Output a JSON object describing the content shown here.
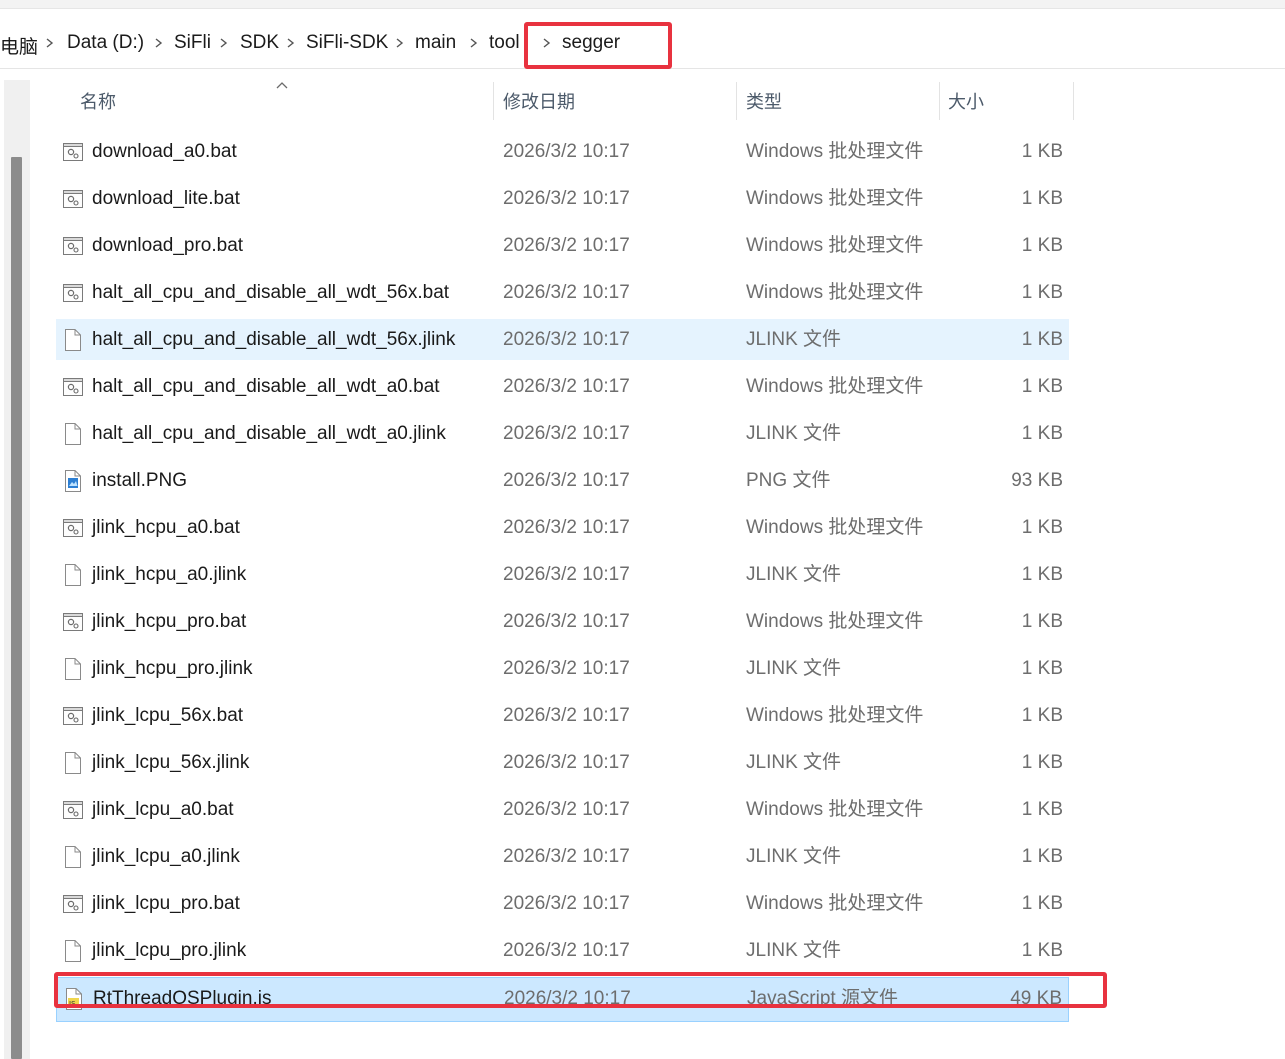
{
  "breadcrumb": {
    "items": [
      "电脑",
      "Data (D:)",
      "SiFli",
      "SDK",
      "SiFli-SDK",
      "main",
      "tool",
      "segger"
    ]
  },
  "columns": {
    "name": "名称",
    "date": "修改日期",
    "type": "类型",
    "size": "大小"
  },
  "files": [
    {
      "name": "download_a0.bat",
      "date": "2026/3/2 10:17",
      "type": "Windows 批处理文件",
      "size": "1 KB",
      "icon": "batch-file-icon"
    },
    {
      "name": "download_lite.bat",
      "date": "2026/3/2 10:17",
      "type": "Windows 批处理文件",
      "size": "1 KB",
      "icon": "batch-file-icon"
    },
    {
      "name": "download_pro.bat",
      "date": "2026/3/2 10:17",
      "type": "Windows 批处理文件",
      "size": "1 KB",
      "icon": "batch-file-icon"
    },
    {
      "name": "halt_all_cpu_and_disable_all_wdt_56x.bat",
      "date": "2026/3/2 10:17",
      "type": "Windows 批处理文件",
      "size": "1 KB",
      "icon": "batch-file-icon"
    },
    {
      "name": "halt_all_cpu_and_disable_all_wdt_56x.jlink",
      "date": "2026/3/2 10:17",
      "type": "JLINK 文件",
      "size": "1 KB",
      "icon": "blank-file-icon",
      "state": "hover"
    },
    {
      "name": "halt_all_cpu_and_disable_all_wdt_a0.bat",
      "date": "2026/3/2 10:17",
      "type": "Windows 批处理文件",
      "size": "1 KB",
      "icon": "batch-file-icon"
    },
    {
      "name": "halt_all_cpu_and_disable_all_wdt_a0.jlink",
      "date": "2026/3/2 10:17",
      "type": "JLINK 文件",
      "size": "1 KB",
      "icon": "blank-file-icon"
    },
    {
      "name": "install.PNG",
      "date": "2026/3/2 10:17",
      "type": "PNG 文件",
      "size": "93 KB",
      "icon": "image-file-icon"
    },
    {
      "name": "jlink_hcpu_a0.bat",
      "date": "2026/3/2 10:17",
      "type": "Windows 批处理文件",
      "size": "1 KB",
      "icon": "batch-file-icon"
    },
    {
      "name": "jlink_hcpu_a0.jlink",
      "date": "2026/3/2 10:17",
      "type": "JLINK 文件",
      "size": "1 KB",
      "icon": "blank-file-icon"
    },
    {
      "name": "jlink_hcpu_pro.bat",
      "date": "2026/3/2 10:17",
      "type": "Windows 批处理文件",
      "size": "1 KB",
      "icon": "batch-file-icon"
    },
    {
      "name": "jlink_hcpu_pro.jlink",
      "date": "2026/3/2 10:17",
      "type": "JLINK 文件",
      "size": "1 KB",
      "icon": "blank-file-icon"
    },
    {
      "name": "jlink_lcpu_56x.bat",
      "date": "2026/3/2 10:17",
      "type": "Windows 批处理文件",
      "size": "1 KB",
      "icon": "batch-file-icon"
    },
    {
      "name": "jlink_lcpu_56x.jlink",
      "date": "2026/3/2 10:17",
      "type": "JLINK 文件",
      "size": "1 KB",
      "icon": "blank-file-icon"
    },
    {
      "name": "jlink_lcpu_a0.bat",
      "date": "2026/3/2 10:17",
      "type": "Windows 批处理文件",
      "size": "1 KB",
      "icon": "batch-file-icon"
    },
    {
      "name": "jlink_lcpu_a0.jlink",
      "date": "2026/3/2 10:17",
      "type": "JLINK 文件",
      "size": "1 KB",
      "icon": "blank-file-icon"
    },
    {
      "name": "jlink_lcpu_pro.bat",
      "date": "2026/3/2 10:17",
      "type": "Windows 批处理文件",
      "size": "1 KB",
      "icon": "batch-file-icon"
    },
    {
      "name": "jlink_lcpu_pro.jlink",
      "date": "2026/3/2 10:17",
      "type": "JLINK 文件",
      "size": "1 KB",
      "icon": "blank-file-icon"
    },
    {
      "name": "RtThreadOSPlugin.js",
      "date": "2026/3/2 10:17",
      "type": "JavaScript 源文件",
      "size": "49 KB",
      "icon": "javascript-file-icon",
      "state": "selected"
    }
  ],
  "colors": {
    "annotation": "#e8323f",
    "hover": "#e5f3fe",
    "selected": "#cce8ff"
  }
}
